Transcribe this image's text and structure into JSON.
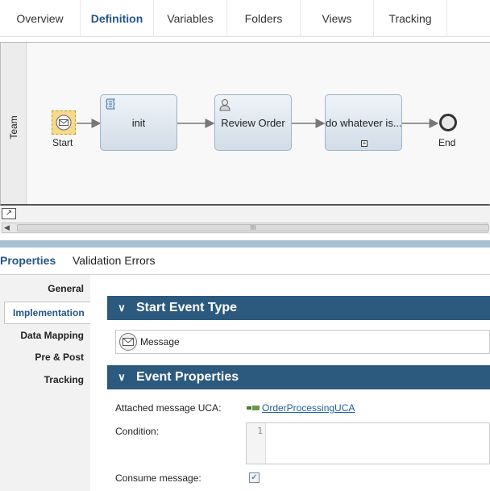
{
  "tabs": [
    "Overview",
    "Definition",
    "Variables",
    "Folders",
    "Views",
    "Tracking"
  ],
  "active_tab": "Definition",
  "diagram": {
    "lane_label": "Team",
    "start_label": "Start",
    "end_label": "End",
    "nodes": [
      "init",
      "Review Order",
      "do whatever is..."
    ],
    "scrollbar_grip": "III"
  },
  "properties": {
    "tabs": [
      "Properties",
      "Validation Errors"
    ],
    "side_items": [
      "General",
      "Implementation",
      "Data Mapping",
      "Pre & Post",
      "Tracking"
    ],
    "active_side_item": "Implementation",
    "start_event_type_header": "Start Event Type",
    "event_type": "Message",
    "event_properties_header": "Event Properties",
    "attached_uca_label": "Attached message UCA:",
    "attached_uca_value": "OrderProcessingUCA",
    "condition_label": "Condition:",
    "condition_line_number": "1",
    "consume_label": "Consume message:",
    "consume_checked": true
  },
  "colors": {
    "accent": "#25568a",
    "section_header": "#2c5a7e",
    "divider": "#a9c2d2",
    "start_event": "#f7d98d"
  }
}
